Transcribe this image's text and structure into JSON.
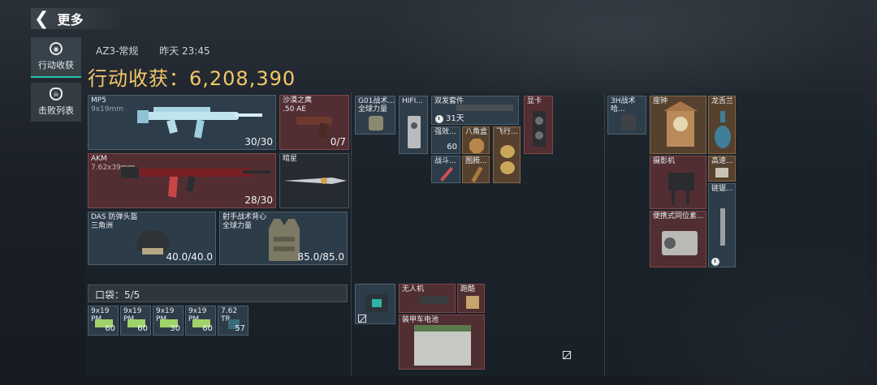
{
  "header": {
    "back_label": "更多"
  },
  "nav": [
    {
      "label": "行动收获"
    },
    {
      "label": "击败列表"
    }
  ],
  "meta": {
    "mode": "AZ3-常规",
    "time": "昨天 23:45"
  },
  "summary": {
    "title": "行动收获：6,208,390"
  },
  "gear": {
    "primary1": {
      "name": "MP5",
      "sub": "9x19mm",
      "ammo": "30/30"
    },
    "pistol": {
      "name": "沙漠之鹰",
      "sub": ".50 AE",
      "ammo": "0/7"
    },
    "primary2": {
      "name": "AKM",
      "sub": "7.62x39mm",
      "ammo": "28/30"
    },
    "melee": {
      "name": "暗星"
    },
    "helmet": {
      "name": "DAS 防弹头盔",
      "sub": "三角洲",
      "durability": "40.0/40.0"
    },
    "vest": {
      "name": "射手战术背心",
      "sub": "全球力量",
      "durability": "85.0/85.0"
    }
  },
  "pocket": {
    "title": "口袋：5/5",
    "items": [
      {
        "name": "9x19\nPM",
        "count": "60"
      },
      {
        "name": "9x19\nPM",
        "count": "60"
      },
      {
        "name": "9x19\nPM",
        "count": "30"
      },
      {
        "name": "9x19\nPM",
        "count": "60"
      },
      {
        "name": "7.62\nTR",
        "count": "57"
      }
    ]
  },
  "loot_a": [
    {
      "name": "G01战术...\n全球力量"
    },
    {
      "name": "HIFI..."
    },
    {
      "name": "双发套件",
      "timer": "31天"
    },
    {
      "name": "显卡"
    },
    {
      "name": "强效...",
      "count": "60"
    },
    {
      "name": "八角盒"
    },
    {
      "name": "飞行..."
    },
    {
      "name": "战斗..."
    },
    {
      "name": "图腾..."
    }
  ],
  "loot_b": [
    {
      "name": "3H战术\n哈..."
    },
    {
      "name": "座钟"
    },
    {
      "name": "龙舌兰"
    },
    {
      "name": "摄影机"
    },
    {
      "name": "高速..."
    },
    {
      "name": "链锯..."
    },
    {
      "name": "便携式同位素..."
    }
  ],
  "backpack": [
    {
      "name": "无人机"
    },
    {
      "name": "跑酷"
    },
    {
      "name": "装甲车电池"
    }
  ],
  "colors": {
    "accent": "#27c4b0",
    "title": "#f4c869"
  }
}
